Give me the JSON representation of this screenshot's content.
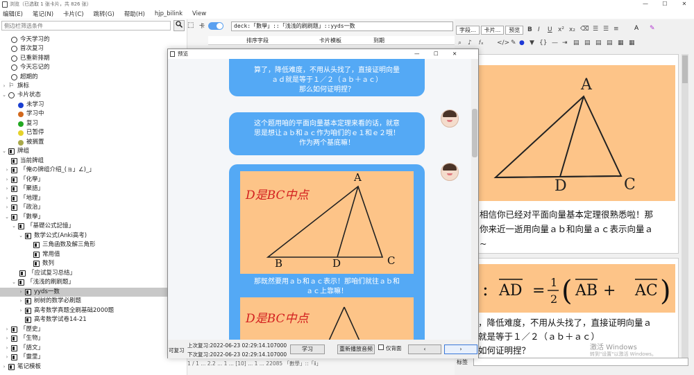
{
  "window": {
    "title": "浏览（已选取 1 张卡片，共 826 张）",
    "controls": [
      "—",
      "☐",
      "✕"
    ]
  },
  "menu": [
    "编辑(E)",
    "笔记(N)",
    "卡片(C)",
    "跳转(G)",
    "帮助(H)",
    "hjp_bilink",
    "View"
  ],
  "sidebar": {
    "search_placeholder": "侧边栏筛选条件",
    "items": [
      {
        "label": "今天学习的",
        "icon": "clock-icon"
      },
      {
        "label": "首次复习",
        "icon": "clock-icon"
      },
      {
        "label": "已重新排期",
        "icon": "clock-icon"
      },
      {
        "label": "今天忘记的",
        "icon": "clock-icon"
      },
      {
        "label": "超期的",
        "icon": "clock-icon"
      },
      {
        "label": "旗标",
        "icon": "flag-icon"
      },
      {
        "label": "卡片状态",
        "icon": "circle-icon"
      },
      {
        "label": "未学习",
        "color": "#1a3fd1"
      },
      {
        "label": "学习中",
        "color": "#d2691e"
      },
      {
        "label": "复习",
        "color": "#22a822"
      },
      {
        "label": "已暂停",
        "color": "#e5d22a"
      },
      {
        "label": "被搁置",
        "color": "#a8a84a"
      },
      {
        "label": "牌组",
        "icon": "deck-icon"
      },
      {
        "label": "当前牌组",
        "icon": "deck-icon"
      },
      {
        "label": "「俺の牌组介绍_(ョ」∠)_」",
        "icon": "deck-icon"
      },
      {
        "label": "「化學」",
        "icon": "deck-icon"
      },
      {
        "label": "「聚語」",
        "icon": "deck-icon"
      },
      {
        "label": "「地理」",
        "icon": "deck-icon"
      },
      {
        "label": "「政治」",
        "icon": "deck-icon"
      },
      {
        "label": "「數學」",
        "icon": "deck-icon"
      },
      {
        "label": "「基礎公式記憶」",
        "icon": "deck-icon"
      },
      {
        "label": "数学公式(Anki高考)",
        "icon": "deck-icon"
      },
      {
        "label": "三角函数及解三角形",
        "icon": "deck-icon"
      },
      {
        "label": "常用值",
        "icon": "deck-icon"
      },
      {
        "label": "数列",
        "icon": "deck-icon"
      },
      {
        "label": "「应试复习总结」",
        "icon": "deck-icon"
      },
      {
        "label": "「浅浅的刷刷题」",
        "icon": "deck-icon"
      },
      {
        "label": "yyds一数",
        "icon": "deck-icon"
      },
      {
        "label": "树树的数学必刷题",
        "icon": "deck-icon"
      },
      {
        "label": "高考数学真题全刷基础2000题",
        "icon": "deck-icon"
      },
      {
        "label": "高考数学试卷14-21",
        "icon": "deck-icon"
      },
      {
        "label": "「歷史」",
        "icon": "deck-icon"
      },
      {
        "label": "「生物」",
        "icon": "deck-icon"
      },
      {
        "label": "「語文」",
        "icon": "deck-icon"
      },
      {
        "label": "「靈里」",
        "icon": "deck-icon"
      },
      {
        "label": "笔记模板",
        "icon": "template-icon"
      }
    ]
  },
  "browser": {
    "toggle_label": "卡",
    "search_value": "deck:「數學」::「浅浅的刷刷题」::yyds一数",
    "columns": [
      "排序字段",
      "卡片模板",
      "到期"
    ]
  },
  "editor": {
    "tabs": [
      "字段...",
      "卡片...",
      "预览"
    ],
    "format_buttons": [
      "B",
      "I",
      "U",
      "x²",
      "x₂"
    ],
    "card_text_1": "相信你已经对平面向量基本定理很熟悉啦！那你来近一逝用向量ａｂ和向量ａｃ表示向量ａ~",
    "card_text_1a": "相信你已经对平面向量基本定理很熟悉啦！那",
    "card_text_1b": "你来近一逝用向量ａｂ和向量ａｃ表示向量ａ",
    "card_text_1c": "~",
    "card_text_2a": "，降低难度，不用从头找了，直接证明向量ａ",
    "card_text_2b": "就是等于１／２（ａｂ＋ａｃ）",
    "card_text_2c": "如何证明捏？",
    "tag_label": "标签",
    "watermark": "激活 Windows",
    "watermark_sub": "转到\"设置\"以激活 Windows。"
  },
  "preview": {
    "title": "预览",
    "bubble1_line1": "算了，降低难度，不用从头找了，直接证明向量",
    "bubble1_line2": "ａｄ就是等于１／２（ａｂ＋ａｃ）",
    "bubble1_line3": "那么如何证明捏？",
    "bubble2_line1": "这个题用咱的平面向量基本定理来看的话，就意",
    "bubble2_line2": "思是想让ａｂ和ａｃ作为咱们的ｅ１和ｅ２哦！",
    "bubble2_line3": "作为两个基底嘛！",
    "bubble3_line1": "那既然要用ａｂ和ａｃ表示！那咱们就往ａｂ和",
    "bubble3_line2": "ａｃ上靠嘛！",
    "handwriting": "D是BC中点",
    "label_A": "A",
    "label_B": "B",
    "label_C": "C",
    "label_D": "D",
    "left_label": "可复习",
    "last_review": "上次复习:2022-06-23 02:29:14.107000",
    "next_review": "下次复习:2022-06-23 02:29:14.107000",
    "study_button": "学习",
    "replay_button": "重新播放音频",
    "back_only_label": "仅背面",
    "prev_button": "‹",
    "next_button": "›"
  },
  "status": {
    "row_text": "1 / 1 ...  2.2 ...  1 ...  [10] ...  1 ...  22085  「數學」::「ⅱ」"
  }
}
